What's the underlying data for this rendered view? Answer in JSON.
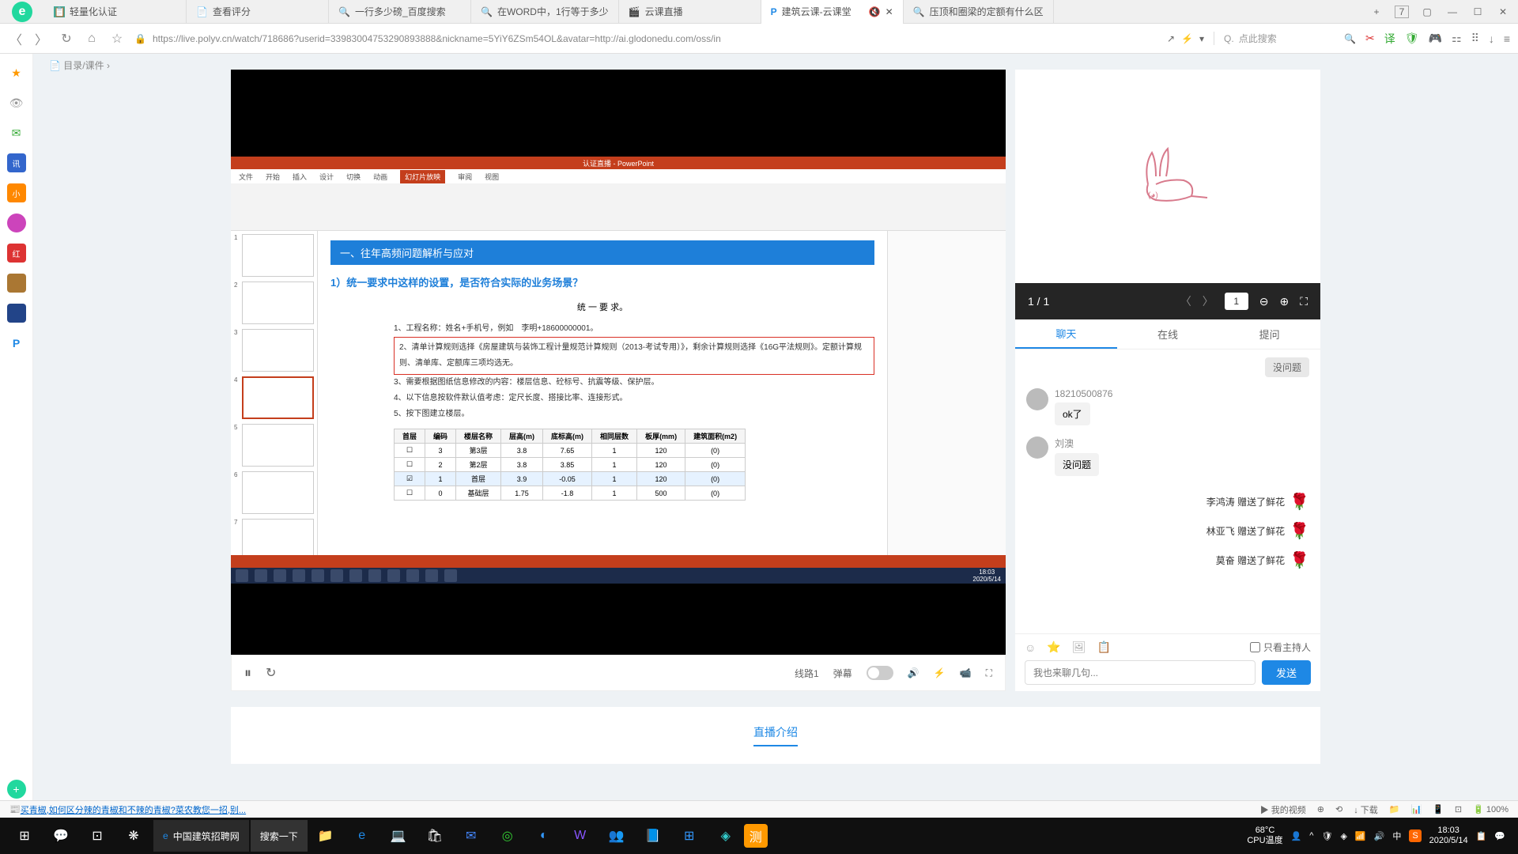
{
  "browser": {
    "tabs": [
      {
        "icon": "📋",
        "label": "轻量化认证"
      },
      {
        "icon": "📄",
        "label": "查看评分"
      },
      {
        "icon": "🔍",
        "label": "一行多少磅_百度搜索"
      },
      {
        "icon": "🔍",
        "label": "在WORD中，1行等于多少"
      },
      {
        "icon": "🎬",
        "label": "云课直播"
      },
      {
        "icon": "P",
        "label": "建筑云课-云课堂",
        "active": true
      },
      {
        "icon": "🔍",
        "label": "压顶和圈梁的定额有什么区"
      }
    ],
    "tab_counter": "7",
    "url": "https://live.polyv.cn/watch/718686?userid=33983004753290893888&nickname=5YiY6ZSm54OL&avatar=http://ai.glodonedu.com/oss/in",
    "search_placeholder": "点此搜索"
  },
  "video": {
    "ppt_title": "认证直播 - PowerPoint",
    "ribbon_tabs": [
      "文件",
      "开始",
      "插入",
      "设计",
      "切换",
      "动画",
      "幻灯片放映",
      "审阅",
      "视图"
    ],
    "slide_title": "一、往年高频问题解析与应对",
    "slide_question": "1）统一要求中这样的设置，是否符合实际的业务场景？",
    "slide_subtitle": "统 一 要 求。",
    "slide_items": [
      "1、工程名称：姓名+手机号，例如　李明+18600000001。",
      "2、清单计算规则选择《房屋建筑与装饰工程计量规范计算规则（2013-考试专用）》，剩余计算规则选择《16G平法规则》。定额计算规则、清单库、定额库三项均选无。",
      "3、需要根据图纸信息修改的内容：楼层信息、砼标号、抗震等级、保护层。",
      "4、以下信息按软件默认值考虑：定尺长度、搭接比率、连接形式。",
      "5、按下图建立楼层。"
    ],
    "table": {
      "headers": [
        "首层",
        "编码",
        "楼层名称",
        "层高(m)",
        "底标高(m)",
        "相同层数",
        "板厚(mm)",
        "建筑面积(m2)"
      ],
      "rows": [
        [
          "☐",
          "3",
          "第3层",
          "3.8",
          "7.65",
          "1",
          "120",
          "(0)"
        ],
        [
          "☐",
          "2",
          "第2层",
          "3.8",
          "3.85",
          "1",
          "120",
          "(0)"
        ],
        [
          "☑",
          "1",
          "首层",
          "3.9",
          "-0.05",
          "1",
          "120",
          "(0)"
        ],
        [
          "☐",
          "0",
          "基础层",
          "1.75",
          "-1.8",
          "1",
          "500",
          "(0)"
        ]
      ]
    },
    "taskbar_time": "18:03",
    "taskbar_date": "2020/5/14",
    "controls": {
      "line": "线路1",
      "danmu": "弹幕"
    }
  },
  "chat": {
    "page_indicator": "1 / 1",
    "page_current": "1",
    "tabs": [
      "聊天",
      "在线",
      "提问"
    ],
    "no_question": "没问题",
    "messages": [
      {
        "type": "user",
        "name": "18210500876",
        "text": "ok了"
      },
      {
        "type": "user",
        "name": "刘澳",
        "text": "没问题"
      },
      {
        "type": "gift",
        "text": "李鸿涛 赠送了鲜花"
      },
      {
        "type": "gift",
        "text": "林亚飞 赠送了鲜花"
      },
      {
        "type": "gift",
        "text": "莫奋 赠送了鲜花"
      }
    ],
    "host_only": "只看主持人",
    "input_placeholder": "我也来聊几句...",
    "send": "发送"
  },
  "intro_tab": "直播介绍",
  "bottom_link": "买青椒,如何区分辣的青椒和不辣的青椒?菜农教您一招,别...",
  "bottom_right": {
    "videos": "我的视频",
    "download": "下载",
    "battery": "100%"
  },
  "windows": {
    "app_title": "中国建筑招聘网",
    "search": "搜索一下",
    "temp": "68°C",
    "cpu": "CPU温度",
    "time": "18:03",
    "date": "2020/5/14"
  }
}
